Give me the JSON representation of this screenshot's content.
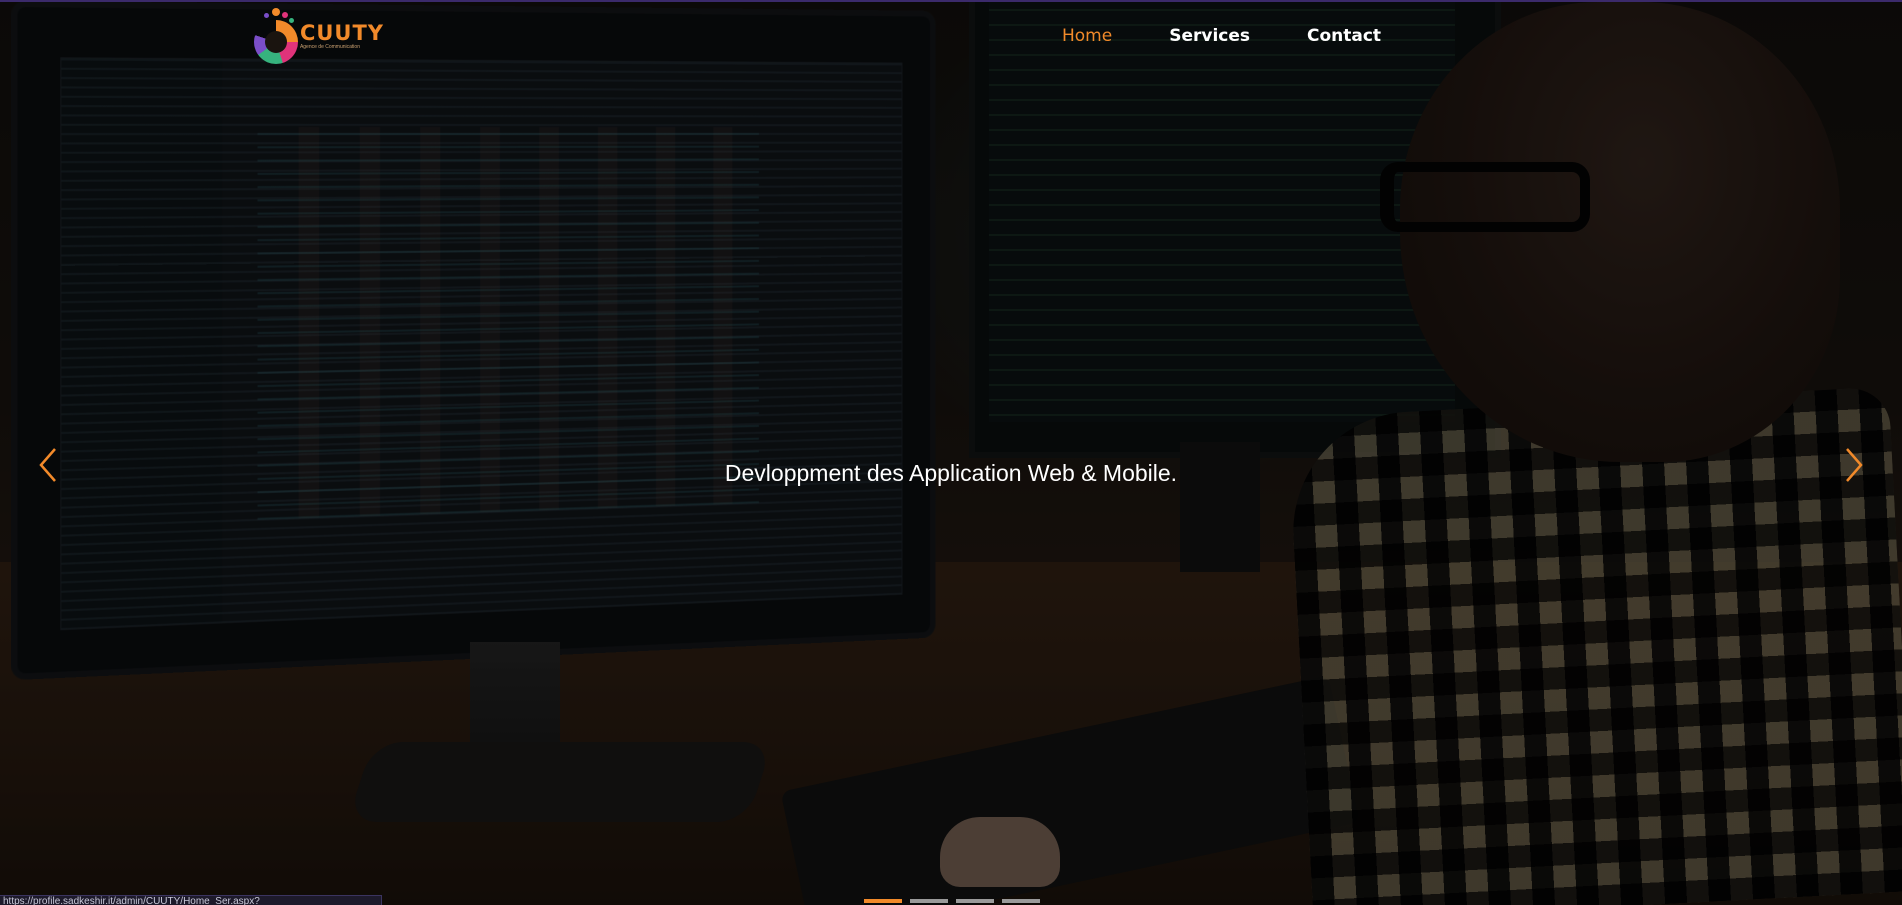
{
  "brand": {
    "name": "CUUTY",
    "tagline": "Agence de Communication",
    "colors": {
      "accent": "#f28a2a",
      "nav_text": "#ffffff"
    }
  },
  "nav": {
    "items": [
      {
        "label": "Home",
        "active": true
      },
      {
        "label": "Services",
        "active": false
      },
      {
        "label": "Contact",
        "active": false
      }
    ]
  },
  "carousel": {
    "caption": "Devloppment des Application Web & Mobile.",
    "prev_icon": "chevron-left-icon",
    "next_icon": "chevron-right-icon",
    "slide_count": 4,
    "active_index": 0
  },
  "status_bar": {
    "url": "https://profile.sadkeshir.it/admin/CUUTY/Home_Ser.aspx?"
  }
}
